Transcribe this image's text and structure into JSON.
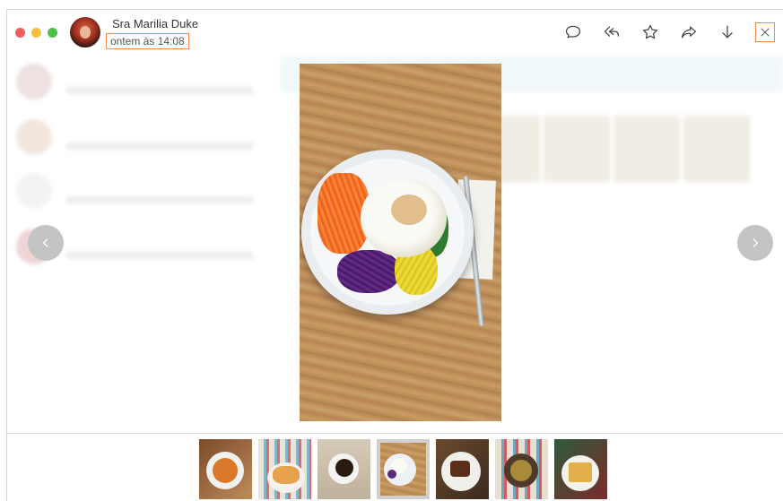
{
  "contact": {
    "name": "Sra Marilia Duke",
    "time": "ontem às 14:08"
  },
  "colors": {
    "highlight": "#f08a4b",
    "traffic_red": "#ee5f57",
    "traffic_yellow": "#f6bd3f",
    "traffic_green": "#4ec144"
  },
  "icons": {
    "comment": "comment-icon",
    "reply": "reply-icon",
    "star": "star-icon",
    "forward": "forward-icon",
    "download": "download-icon",
    "close": "close-icon",
    "prev": "chevron-left-icon",
    "next": "chevron-right-icon"
  },
  "thumbnails": [
    {
      "id": 1,
      "active": false
    },
    {
      "id": 2,
      "active": false
    },
    {
      "id": 3,
      "active": false
    },
    {
      "id": 4,
      "active": true
    },
    {
      "id": 5,
      "active": false
    },
    {
      "id": 6,
      "active": false
    },
    {
      "id": 7,
      "active": false
    }
  ]
}
